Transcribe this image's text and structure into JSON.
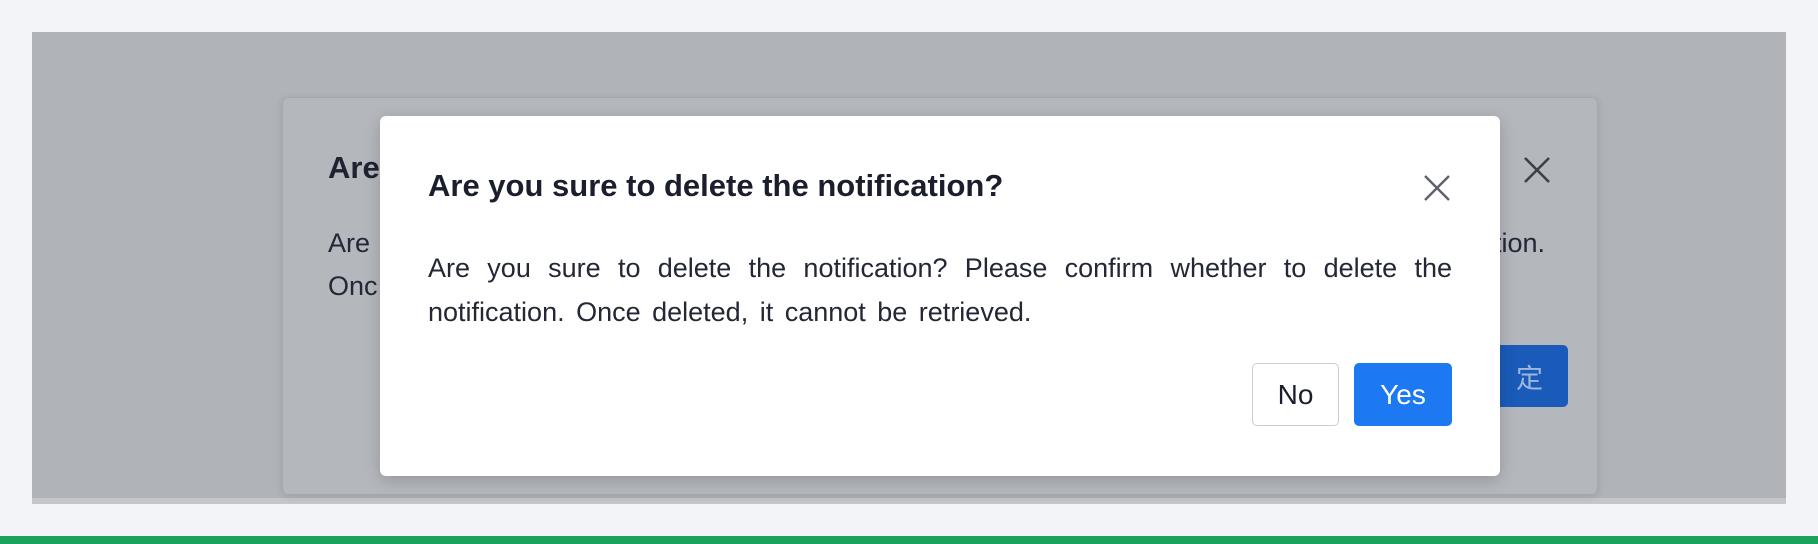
{
  "back_dialog": {
    "title_visible": "Are",
    "body_line1_start": "Are",
    "body_line1_end": "tion.",
    "body_line2_start": "Onc",
    "confirm_label_visible": "定",
    "close_icon": "close-icon"
  },
  "dialog": {
    "title": "Are you sure to delete the notification?",
    "body": "Are you sure to delete the notification? Please confirm whether to delete the notification. Once deleted, it cannot be retrieved.",
    "close_icon": "close-icon",
    "no_label": "No",
    "yes_label": "Yes"
  },
  "colors": {
    "primary": "#1c79f2",
    "overlay": "#b0b3b8",
    "bottom_bar": "#1aa35d"
  }
}
